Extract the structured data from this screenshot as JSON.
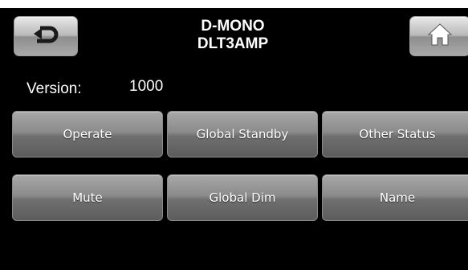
{
  "header": {
    "title_line1": "D-MONO",
    "title_line2": "DLT3AMP",
    "back_icon": "back-arrow-icon",
    "home_icon": "home-icon"
  },
  "version": {
    "label": "Version:",
    "value": "1000"
  },
  "buttons": {
    "row1": [
      "Operate",
      "Global Standby",
      "Other Status"
    ],
    "row2": [
      "Mute",
      "Global Dim",
      "Name"
    ]
  },
  "colors": {
    "background": "#000000",
    "text": "#ffffff",
    "button_face": "#8b8b8b"
  }
}
